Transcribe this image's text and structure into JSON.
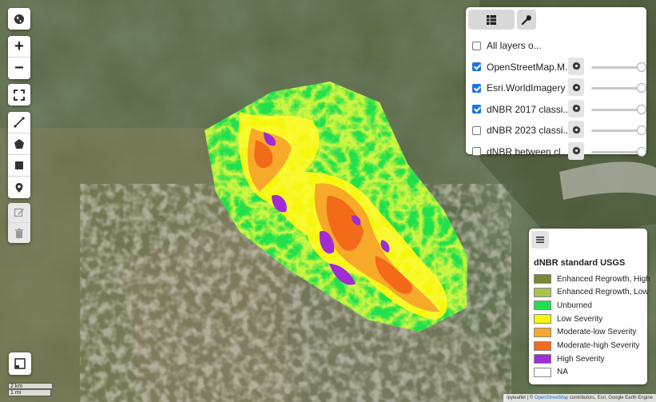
{
  "map": {
    "basemap": "Esri.WorldImagery",
    "overlay_colors": {
      "unburned": "#22e04c",
      "low": "#f3f30a",
      "mod_low": "#f7a92a",
      "mod_high": "#f36a18",
      "high": "#b432d8"
    }
  },
  "toolbar": {
    "globe_icon": "globe-icon",
    "zoom_in_label": "+",
    "zoom_out_label": "−",
    "fullscreen_icon": "fullscreen-icon",
    "draw_tools": [
      "polyline-icon",
      "polygon-icon",
      "rectangle-icon",
      "marker-icon"
    ],
    "edit_tools": [
      "edit-icon",
      "trash-icon"
    ],
    "bottom_icon": "layer-split-icon"
  },
  "layers": {
    "tabs": [
      {
        "icon": "layers-list-icon"
      },
      {
        "icon": "wrench-icon"
      }
    ],
    "items": [
      {
        "label": "All layers o...",
        "checked": false,
        "has_controls": false
      },
      {
        "label": "OpenStreetMap.M...",
        "checked": true,
        "has_controls": true,
        "opacity": 1.0
      },
      {
        "label": "Esri.WorldImagery",
        "checked": true,
        "has_controls": true,
        "opacity": 1.0
      },
      {
        "label": "dNBR 2017 classi...",
        "checked": true,
        "has_controls": true,
        "opacity": 1.0
      },
      {
        "label": "dNBR 2023 classi...",
        "checked": false,
        "has_controls": true,
        "opacity": 1.0
      },
      {
        "label": "dNBR between cl...",
        "checked": false,
        "has_controls": true,
        "opacity": 1.0
      }
    ]
  },
  "legend": {
    "toggle_icon": "menu-icon",
    "title": "dNBR standard USGS",
    "items": [
      {
        "label": "Enhanced Regrowth, High",
        "color": "#7a8734"
      },
      {
        "label": "Enhanced Regrowth, Low",
        "color": "#a8c34f"
      },
      {
        "label": "Unburned",
        "color": "#22e04c"
      },
      {
        "label": "Low Severity",
        "color": "#f7f70c"
      },
      {
        "label": "Moderate-low Severity",
        "color": "#f7a92a"
      },
      {
        "label": "Moderate-high Severity",
        "color": "#f36a18"
      },
      {
        "label": "High Severity",
        "color": "#a12bd4"
      },
      {
        "label": "NA",
        "color": "#ffffff"
      }
    ]
  },
  "scale": {
    "km": "2 km",
    "mi": "1 mi"
  },
  "attribution": {
    "prefix": "ipyleaflet | © ",
    "osm_link": "OpenStreetMap",
    "suffix": " contributors, Esri, Google Earth Engine"
  }
}
